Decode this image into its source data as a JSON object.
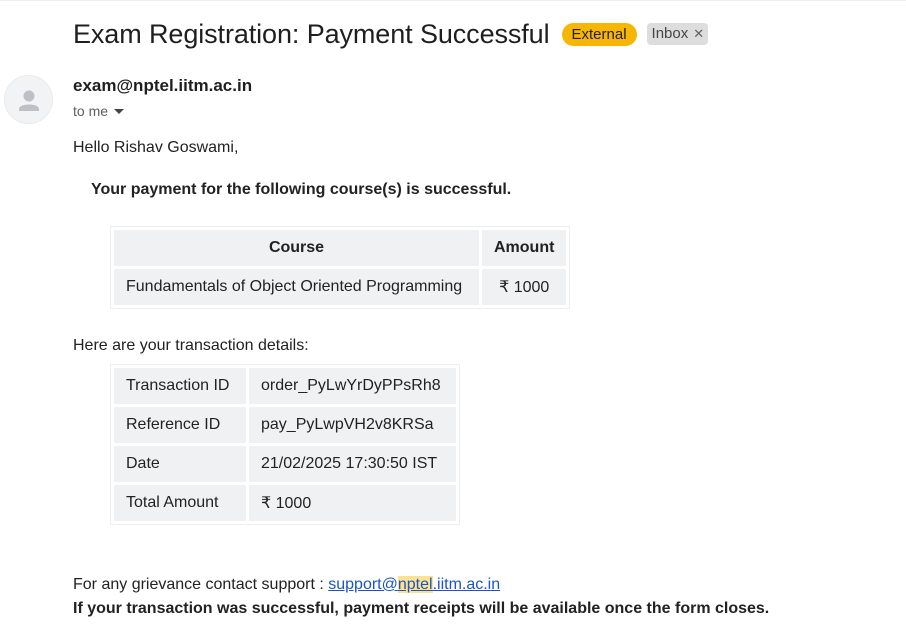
{
  "email": {
    "subject": "Exam Registration: Payment Successful",
    "labels": {
      "external": "External",
      "inbox": "Inbox"
    },
    "sender": "exam@nptel.iitm.ac.in",
    "recipient": "to me"
  },
  "body": {
    "greeting": "Hello Rishav Goswami,",
    "success_message": "Your payment for the following course(s) is successful.",
    "course_table": {
      "headers": [
        "Course",
        "Amount"
      ],
      "rows": [
        {
          "course": "Fundamentals of Object Oriented Programming",
          "amount": "₹ 1000"
        }
      ]
    },
    "details_label": "Here are your transaction details:",
    "transaction": [
      {
        "label": "Transaction ID",
        "value": "order_PyLwYrDyPPsRh8"
      },
      {
        "label": "Reference ID",
        "value": "pay_PyLwpVH2v8KRSa"
      },
      {
        "label": "Date",
        "value": "21/02/2025 17:30:50 IST"
      },
      {
        "label": "Total Amount",
        "value": "₹ 1000"
      }
    ],
    "support_prefix": "For any grievance contact support : ",
    "support_email": {
      "part1": "support@",
      "highlight": "nptel",
      "part2": ".iitm.ac.in"
    },
    "note": "If your transaction was successful, payment receipts will be available once the form closes."
  },
  "colors": {
    "external_badge": "#f7b604",
    "inbox_badge": "#dddddd",
    "link": "#1a55c8",
    "highlight": "#fde293"
  },
  "icons": {
    "avatar": "person-icon",
    "label_close": "close-icon",
    "recipient_toggle": "caret-down-icon"
  }
}
